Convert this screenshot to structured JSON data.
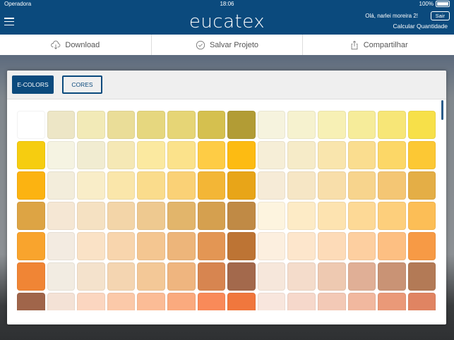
{
  "status_bar": {
    "carrier": "Operadora",
    "time": "18:06",
    "battery": "100%"
  },
  "header": {
    "logo": "eucatex",
    "greeting": "Olá, narlei moreira 2!",
    "logout_label": "Sair",
    "calc_label": "Calcular Quantidade"
  },
  "actions": {
    "download": "Download",
    "save": "Salvar Projeto",
    "share": "Compartilhar"
  },
  "tabs": {
    "ecolors": "E-COLORS",
    "cores": "CORES"
  },
  "swatches": [
    [
      "#ffffff",
      "#ede6c6",
      "#f2eab7",
      "#eadd98",
      "#e6d77f",
      "#e6d576",
      "#d5c04f",
      "#b29c35",
      "#f6f3de",
      "#f6f2cf",
      "#f7f0b5",
      "#f6ec9a",
      "#f7e677",
      "#f7e049"
    ],
    [
      "#f6cd10",
      "#f5f3e2",
      "#f1ecd1",
      "#f5e8b5",
      "#fbe9a0",
      "#fbe28b",
      "#fecc45",
      "#fdbb12",
      "#f6eed7",
      "#f6ebc8",
      "#f9e5ad",
      "#fadd8f",
      "#fcd767",
      "#fcc834"
    ],
    [
      "#fcb311",
      "#f3eddb",
      "#f9edc8",
      "#fae6aa",
      "#fadc8c",
      "#fad176",
      "#f3b636",
      "#e8a518",
      "#f6ebd7",
      "#f6e6c5",
      "#f8deaa",
      "#f7d48d",
      "#f4c674",
      "#e4ae46"
    ],
    [
      "#dda444",
      "#f5e7d4",
      "#f5e1c2",
      "#f3d5a8",
      "#eec990",
      "#e2b56b",
      "#d5a04f",
      "#c08a45",
      "#fdf4df",
      "#fdebc6",
      "#fde3b0",
      "#fdd996",
      "#fdcf7c",
      "#fcbe56"
    ],
    [
      "#f9a42d",
      "#f3ebe1",
      "#fae2c6",
      "#f8d5ad",
      "#f4c691",
      "#edb57a",
      "#e39654",
      "#bd7434",
      "#fcefdf",
      "#fde6cc",
      "#fddbb8",
      "#fdcfa0",
      "#fdbf82",
      "#f79a45"
    ],
    [
      "#f08535",
      "#f2ece2",
      "#f4e2cc",
      "#f4d5b1",
      "#f3c897",
      "#efb57f",
      "#d78550",
      "#a3694c",
      "#f6e7db",
      "#f4dccb",
      "#eec9b1",
      "#e0af96",
      "#c99375",
      "#b37a56"
    ],
    [
      "#a0654a",
      "#f4e2d6",
      "#fbd6c0",
      "#fbc9a9",
      "#fbbc96",
      "#faaa7e",
      "#f98a59",
      "#f0773d",
      "#f8e6dd",
      "#f6d8cb",
      "#f3c9b6",
      "#f1b89f",
      "#ea9978",
      "#e08462"
    ]
  ]
}
